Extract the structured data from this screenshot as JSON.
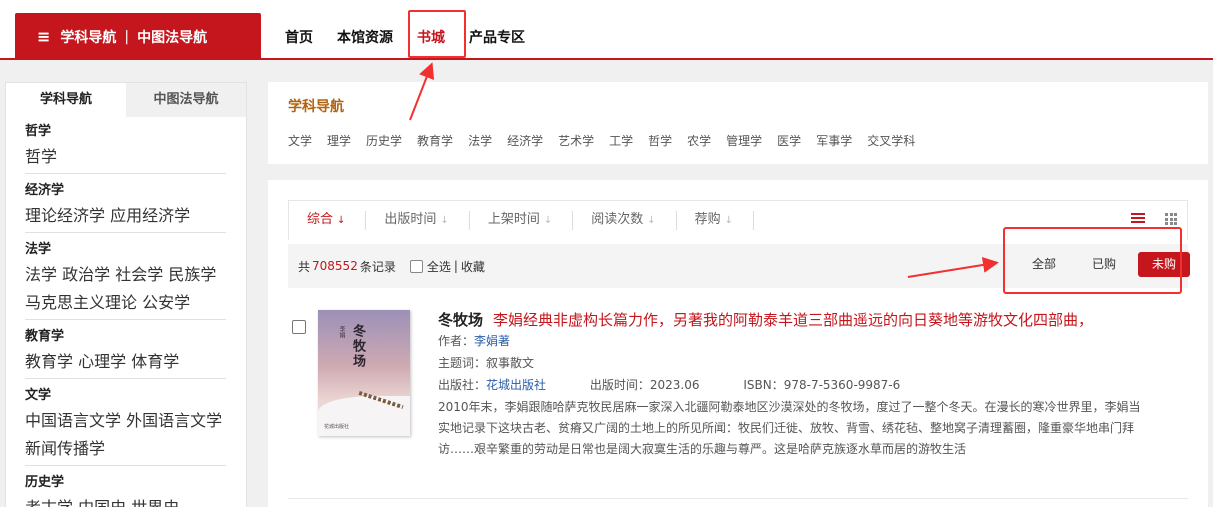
{
  "header": {
    "nav_button": {
      "part1": "学科导航",
      "separator": "|",
      "part2": "中图法导航"
    },
    "menu": [
      {
        "label": "首页"
      },
      {
        "label": "本馆资源"
      },
      {
        "label": "书城"
      },
      {
        "label": "产品专区"
      }
    ],
    "active_menu": "书城"
  },
  "sidebar": {
    "tabs": [
      {
        "label": "学科导航"
      },
      {
        "label": "中图法导航"
      }
    ],
    "categories": [
      {
        "title": "哲学",
        "lines": [
          [
            "哲学"
          ]
        ]
      },
      {
        "title": "经济学",
        "lines": [
          [
            "理论经济学",
            "应用经济学"
          ]
        ]
      },
      {
        "title": "法学",
        "lines": [
          [
            "法学",
            "政治学",
            "社会学",
            "民族学"
          ],
          [
            "马克思主义理论",
            "公安学"
          ]
        ]
      },
      {
        "title": "教育学",
        "lines": [
          [
            "教育学",
            "心理学",
            "体育学"
          ]
        ]
      },
      {
        "title": "文学",
        "lines": [
          [
            "中国语言文学",
            "外国语言文学"
          ],
          [
            "新闻传播学"
          ]
        ]
      },
      {
        "title": "历史学",
        "lines": [
          [
            "考古学",
            "中国史",
            "世界史"
          ]
        ]
      }
    ]
  },
  "subject_panel": {
    "title": "学科导航",
    "items": [
      "文学",
      "理学",
      "历史学",
      "教育学",
      "法学",
      "经济学",
      "艺术学",
      "工学",
      "哲学",
      "农学",
      "管理学",
      "医学",
      "军事学",
      "交叉学科"
    ]
  },
  "results": {
    "sort_options": [
      {
        "label": "综合",
        "arrow": "↓"
      },
      {
        "label": "出版时间",
        "arrow": "↓"
      },
      {
        "label": "上架时间",
        "arrow": "↓"
      },
      {
        "label": "阅读次数",
        "arrow": "↓"
      },
      {
        "label": "荐购",
        "arrow": "↓"
      }
    ],
    "info": {
      "prefix": "共",
      "count": "708552",
      "suffix": "条记录",
      "select_all": "全选",
      "divider": "|",
      "favorite": "收藏"
    },
    "filters": [
      {
        "label": "全部"
      },
      {
        "label": "已购"
      },
      {
        "label": "未购"
      }
    ],
    "active_filter": "未购"
  },
  "book": {
    "cover": {
      "title": "冬牧场",
      "author": "李娟",
      "publisher": "花城出版社"
    },
    "title": "冬牧场",
    "subtitle": "李娟经典非虚构长篇力作，另著我的阿勒泰羊道三部曲遥远的向日葵地等游牧文化四部曲，",
    "author_label": "作者：",
    "author": "李娟著",
    "subject_label": "主题词：",
    "subject": "叙事散文",
    "publisher_label": "出版社：",
    "publisher": "花城出版社",
    "pubdate_label": "出版时间：",
    "pubdate": "2023.06",
    "isbn_label": "ISBN：",
    "isbn": "978-7-5360-9987-6",
    "description": "2010年末，李娟跟随哈萨克牧民居麻一家深入北疆阿勒泰地区沙漠深处的冬牧场，度过了一整个冬天。在漫长的寒冷世界里，李娟当实地记录下这块古老、贫瘠又广阔的土地上的所见所闻：牧民们迁徙、放牧、背雪、绣花毡、整地窝子清理蓄圈，隆重豪华地串门拜访……艰辛繁重的劳动是日常也是阔大寂寞生活的乐趣与尊严。这是哈萨克族逐水草而居的游牧生活"
  },
  "colors": {
    "brand_red": "#c4161c",
    "annotation_red": "#f23030",
    "title_orange": "#b3620e",
    "link_blue": "#2b5ea8"
  }
}
